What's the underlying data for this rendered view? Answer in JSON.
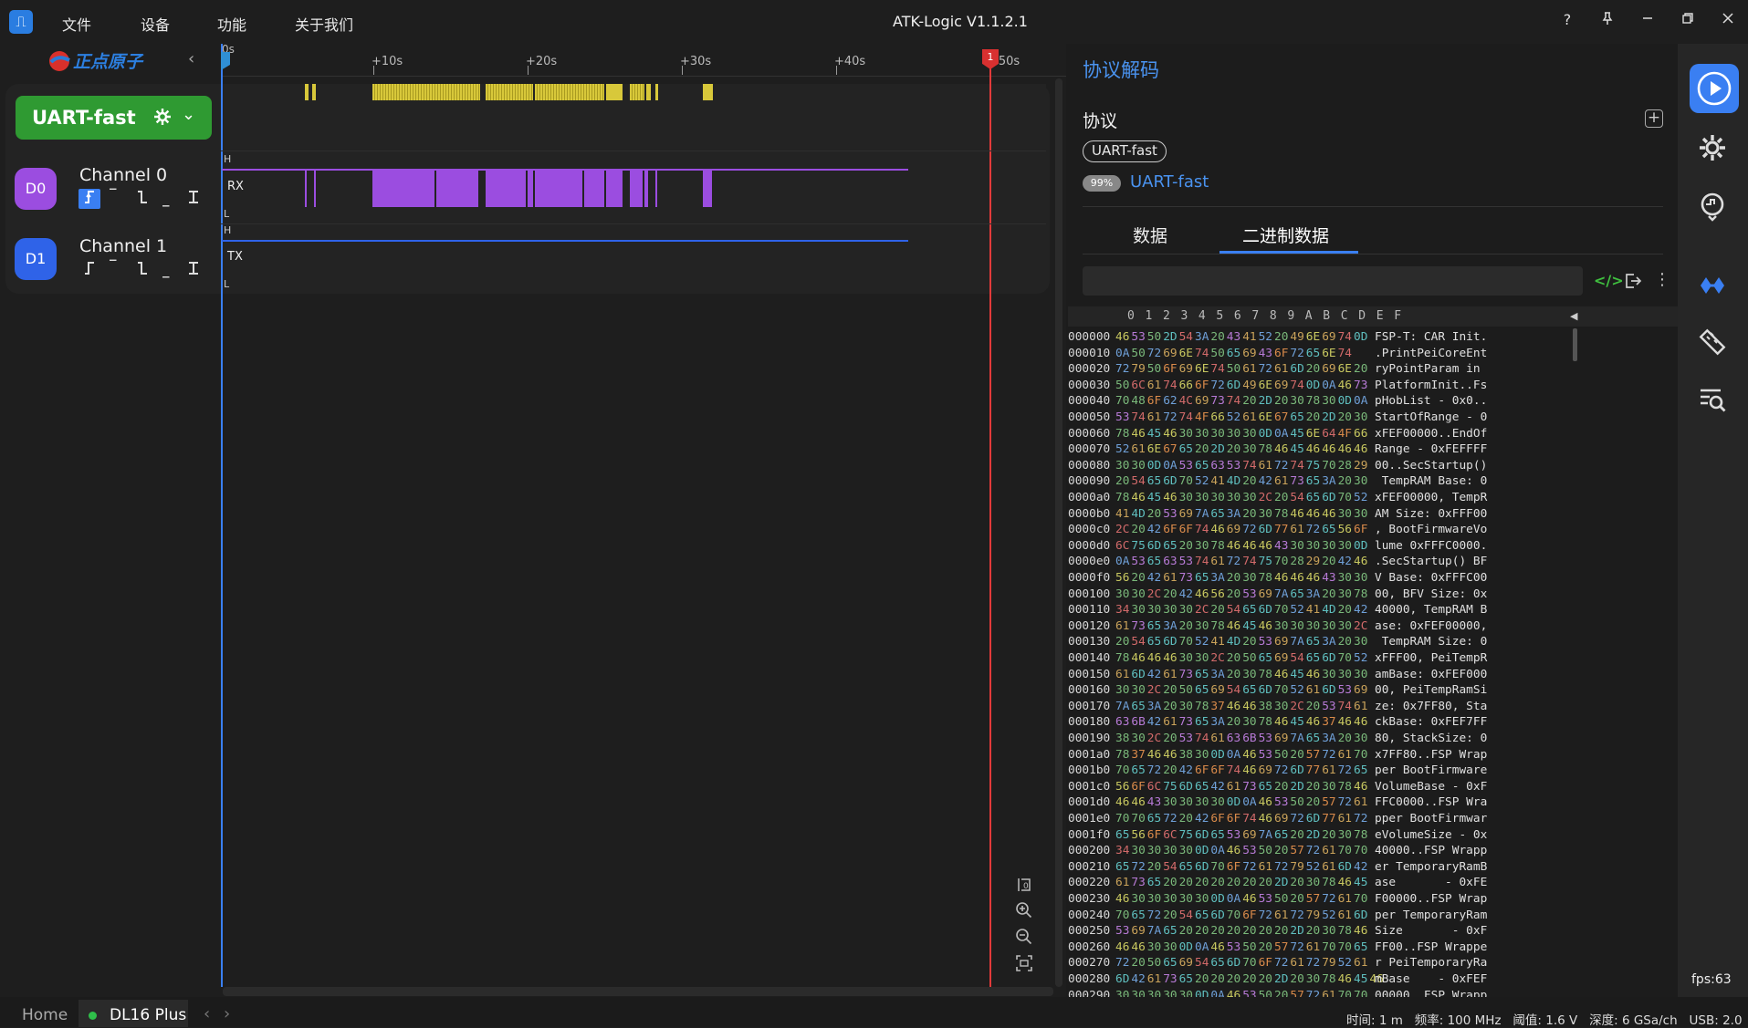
{
  "menu": {
    "logo_glyph": "⎍",
    "items": [
      "文件",
      "设备",
      "功能",
      "关于我们"
    ],
    "title": "ATK-Logic V1.1.2.1",
    "help": "?"
  },
  "brand": {
    "logo_text": "正点原子"
  },
  "protocol_card": {
    "label": "UART-fast"
  },
  "channels": [
    {
      "badge": "D0",
      "name": "Channel 0",
      "color": "#9b4de0",
      "signal": "RX"
    },
    {
      "badge": "D1",
      "name": "Channel 1",
      "color": "#2f63e8",
      "signal": "TX"
    }
  ],
  "timeline": {
    "ticks": [
      "0s",
      "+10s",
      "+20s",
      "+30s",
      "+40s",
      "+50s"
    ],
    "marker": "1",
    "level_high": "H",
    "level_low": "L"
  },
  "decode_panel": {
    "title": "协议解码",
    "protocol_heading": "协议",
    "protocol_tag": "UART-fast",
    "match_percent": "99%",
    "match_name": "UART-fast",
    "tabs": [
      "数据",
      "二进制数据"
    ],
    "active_tab": 1,
    "search_placeholder": "",
    "hex_header": "0  1  2  3  4  5  6  7  8  9  A  B  C  D  E  F"
  },
  "hex_rows": [
    {
      "addr": "000000",
      "bytes": "46 53 50 2D 54 3A 20 43 41 52 20 49 6E 69 74 0D",
      "ascii": "FSP-T: CAR Init."
    },
    {
      "addr": "000010",
      "bytes": "0A 50 72 69 6E 74 50 65 69 43 6F 72 65 6E 74",
      "ascii": ".PrintPeiCoreEnt"
    },
    {
      "addr": "000020",
      "bytes": "72 79 50 6F 69 6E 74 50 61 72 61 6D 20 69 6E 20",
      "ascii": "ryPointParam in "
    },
    {
      "addr": "000030",
      "bytes": "50 6C 61 74 66 6F 72 6D 49 6E 69 74 0D 0A 46 73",
      "ascii": "PlatformInit..Fs"
    },
    {
      "addr": "000040",
      "bytes": "70 48 6F 62 4C 69 73 74 20 2D 20 30 78 30 0D 0A",
      "ascii": "pHobList - 0x0.."
    },
    {
      "addr": "000050",
      "bytes": "53 74 61 72 74 4F 66 52 61 6E 67 65 20 2D 20 30",
      "ascii": "StartOfRange - 0"
    },
    {
      "addr": "000060",
      "bytes": "78 46 45 46 30 30 30 30 30 0D 0A 45 6E 64 4F 66",
      "ascii": "xFEF00000..EndOf"
    },
    {
      "addr": "000070",
      "bytes": "52 61 6E 67 65 20 2D 20 30 78 46 45 46 46 46 46",
      "ascii": "Range - 0xFEFFFF"
    },
    {
      "addr": "000080",
      "bytes": "30 30 0D 0A 53 65 63 53 74 61 72 74 75 70 28 29",
      "ascii": "00..SecStartup()"
    },
    {
      "addr": "000090",
      "bytes": "20 54 65 6D 70 52 41 4D 20 42 61 73 65 3A 20 30",
      "ascii": " TempRAM Base: 0"
    },
    {
      "addr": "0000a0",
      "bytes": "78 46 45 46 30 30 30 30 30 2C 20 54 65 6D 70 52",
      "ascii": "xFEF00000, TempR"
    },
    {
      "addr": "0000b0",
      "bytes": "41 4D 20 53 69 7A 65 3A 20 30 78 46 46 46 30 30",
      "ascii": "AM Size: 0xFFF00"
    },
    {
      "addr": "0000c0",
      "bytes": "2C 20 42 6F 6F 74 46 69 72 6D 77 61 72 65 56 6F",
      "ascii": ", BootFirmwareVo"
    },
    {
      "addr": "0000d0",
      "bytes": "6C 75 6D 65 20 30 78 46 46 46 43 30 30 30 30 0D",
      "ascii": "lume 0xFFFC0000."
    },
    {
      "addr": "0000e0",
      "bytes": "0A 53 65 63 53 74 61 72 74 75 70 28 29 20 42 46",
      "ascii": ".SecStartup() BF"
    },
    {
      "addr": "0000f0",
      "bytes": "56 20 42 61 73 65 3A 20 30 78 46 46 46 43 30 30",
      "ascii": "V Base: 0xFFFC00"
    },
    {
      "addr": "000100",
      "bytes": "30 30 2C 20 42 46 56 20 53 69 7A 65 3A 20 30 78",
      "ascii": "00, BFV Size: 0x"
    },
    {
      "addr": "000110",
      "bytes": "34 30 30 30 30 2C 20 54 65 6D 70 52 41 4D 20 42",
      "ascii": "40000, TempRAM B"
    },
    {
      "addr": "000120",
      "bytes": "61 73 65 3A 20 30 78 46 45 46 30 30 30 30 30 2C",
      "ascii": "ase: 0xFEF00000,"
    },
    {
      "addr": "000130",
      "bytes": "20 54 65 6D 70 52 41 4D 20 53 69 7A 65 3A 20 30",
      "ascii": " TempRAM Size: 0"
    },
    {
      "addr": "000140",
      "bytes": "78 46 46 46 30 30 2C 20 50 65 69 54 65 6D 70 52",
      "ascii": "xFFF00, PeiTempR"
    },
    {
      "addr": "000150",
      "bytes": "61 6D 42 61 73 65 3A 20 30 78 46 45 46 30 30 30",
      "ascii": "amBase: 0xFEF000"
    },
    {
      "addr": "000160",
      "bytes": "30 30 2C 20 50 65 69 54 65 6D 70 52 61 6D 53 69",
      "ascii": "00, PeiTempRamSi"
    },
    {
      "addr": "000170",
      "bytes": "7A 65 3A 20 30 78 37 46 46 38 30 2C 20 53 74 61",
      "ascii": "ze: 0x7FF80, Sta"
    },
    {
      "addr": "000180",
      "bytes": "63 6B 42 61 73 65 3A 20 30 78 46 45 46 37 46 46",
      "ascii": "ckBase: 0xFEF7FF"
    },
    {
      "addr": "000190",
      "bytes": "38 30 2C 20 53 74 61 63 6B 53 69 7A 65 3A 20 30",
      "ascii": "80, StackSize: 0"
    },
    {
      "addr": "0001a0",
      "bytes": "78 37 46 46 38 30 0D 0A 46 53 50 20 57 72 61 70",
      "ascii": "x7FF80..FSP Wrap"
    },
    {
      "addr": "0001b0",
      "bytes": "70 65 72 20 42 6F 6F 74 46 69 72 6D 77 61 72 65",
      "ascii": "per BootFirmware"
    },
    {
      "addr": "0001c0",
      "bytes": "56 6F 6C 75 6D 65 42 61 73 65 20 2D 20 30 78 46",
      "ascii": "VolumeBase - 0xF"
    },
    {
      "addr": "0001d0",
      "bytes": "46 46 43 30 30 30 30 0D 0A 46 53 50 20 57 72 61",
      "ascii": "FFC0000..FSP Wra"
    },
    {
      "addr": "0001e0",
      "bytes": "70 70 65 72 20 42 6F 6F 74 46 69 72 6D 77 61 72",
      "ascii": "pper BootFirmwar"
    },
    {
      "addr": "0001f0",
      "bytes": "65 56 6F 6C 75 6D 65 53 69 7A 65 20 2D 20 30 78",
      "ascii": "eVolumeSize - 0x"
    },
    {
      "addr": "000200",
      "bytes": "34 30 30 30 30 0D 0A 46 53 50 20 57 72 61 70 70",
      "ascii": "40000..FSP Wrapp"
    },
    {
      "addr": "000210",
      "bytes": "65 72 20 54 65 6D 70 6F 72 61 72 79 52 61 6D 42",
      "ascii": "er TemporaryRamB"
    },
    {
      "addr": "000220",
      "bytes": "61 73 65 20 20 20 20 20 20 20 2D 20 30 78 46 45",
      "ascii": "ase       - 0xFE"
    },
    {
      "addr": "000230",
      "bytes": "46 30 30 30 30 30 0D 0A 46 53 50 20 57 72 61 70",
      "ascii": "F00000..FSP Wrap"
    },
    {
      "addr": "000240",
      "bytes": "70 65 72 20 54 65 6D 70 6F 72 61 72 79 52 61 6D",
      "ascii": "per TemporaryRam"
    },
    {
      "addr": "000250",
      "bytes": "53 69 7A 65 20 20 20 20 20 20 20 2D 20 30 78 46",
      "ascii": "Size       - 0xF"
    },
    {
      "addr": "000260",
      "bytes": "46 46 30 30 0D 0A 46 53 50 20 57 72 61 70 70 65",
      "ascii": "FF00..FSP Wrappe"
    },
    {
      "addr": "000270",
      "bytes": "72 20 50 65 69 54 65 6D 70 6F 72 61 72 79 52 61",
      "ascii": "r PeiTemporaryRa"
    },
    {
      "addr": "000280",
      "bytes": "6D 42 61 73 65 20 20 20 20 20 2D 20 30 78 46 45 46",
      "ascii": "mBase    - 0xFEF"
    },
    {
      "addr": "000290",
      "bytes": "30 30 30 30 30 0D 0A 46 53 50 20 57 72 61 70 70",
      "ascii": "00000..FSP Wrapp"
    }
  ],
  "sidebar": {
    "fps": "fps:63"
  },
  "statusbar": {
    "home": "Home",
    "device": "DL16 Plus",
    "info": "时间: 1 m   频率: 100 MHz   阈值: 1.6 V   深度: 6 GSa/ch   USB: 2.0"
  }
}
